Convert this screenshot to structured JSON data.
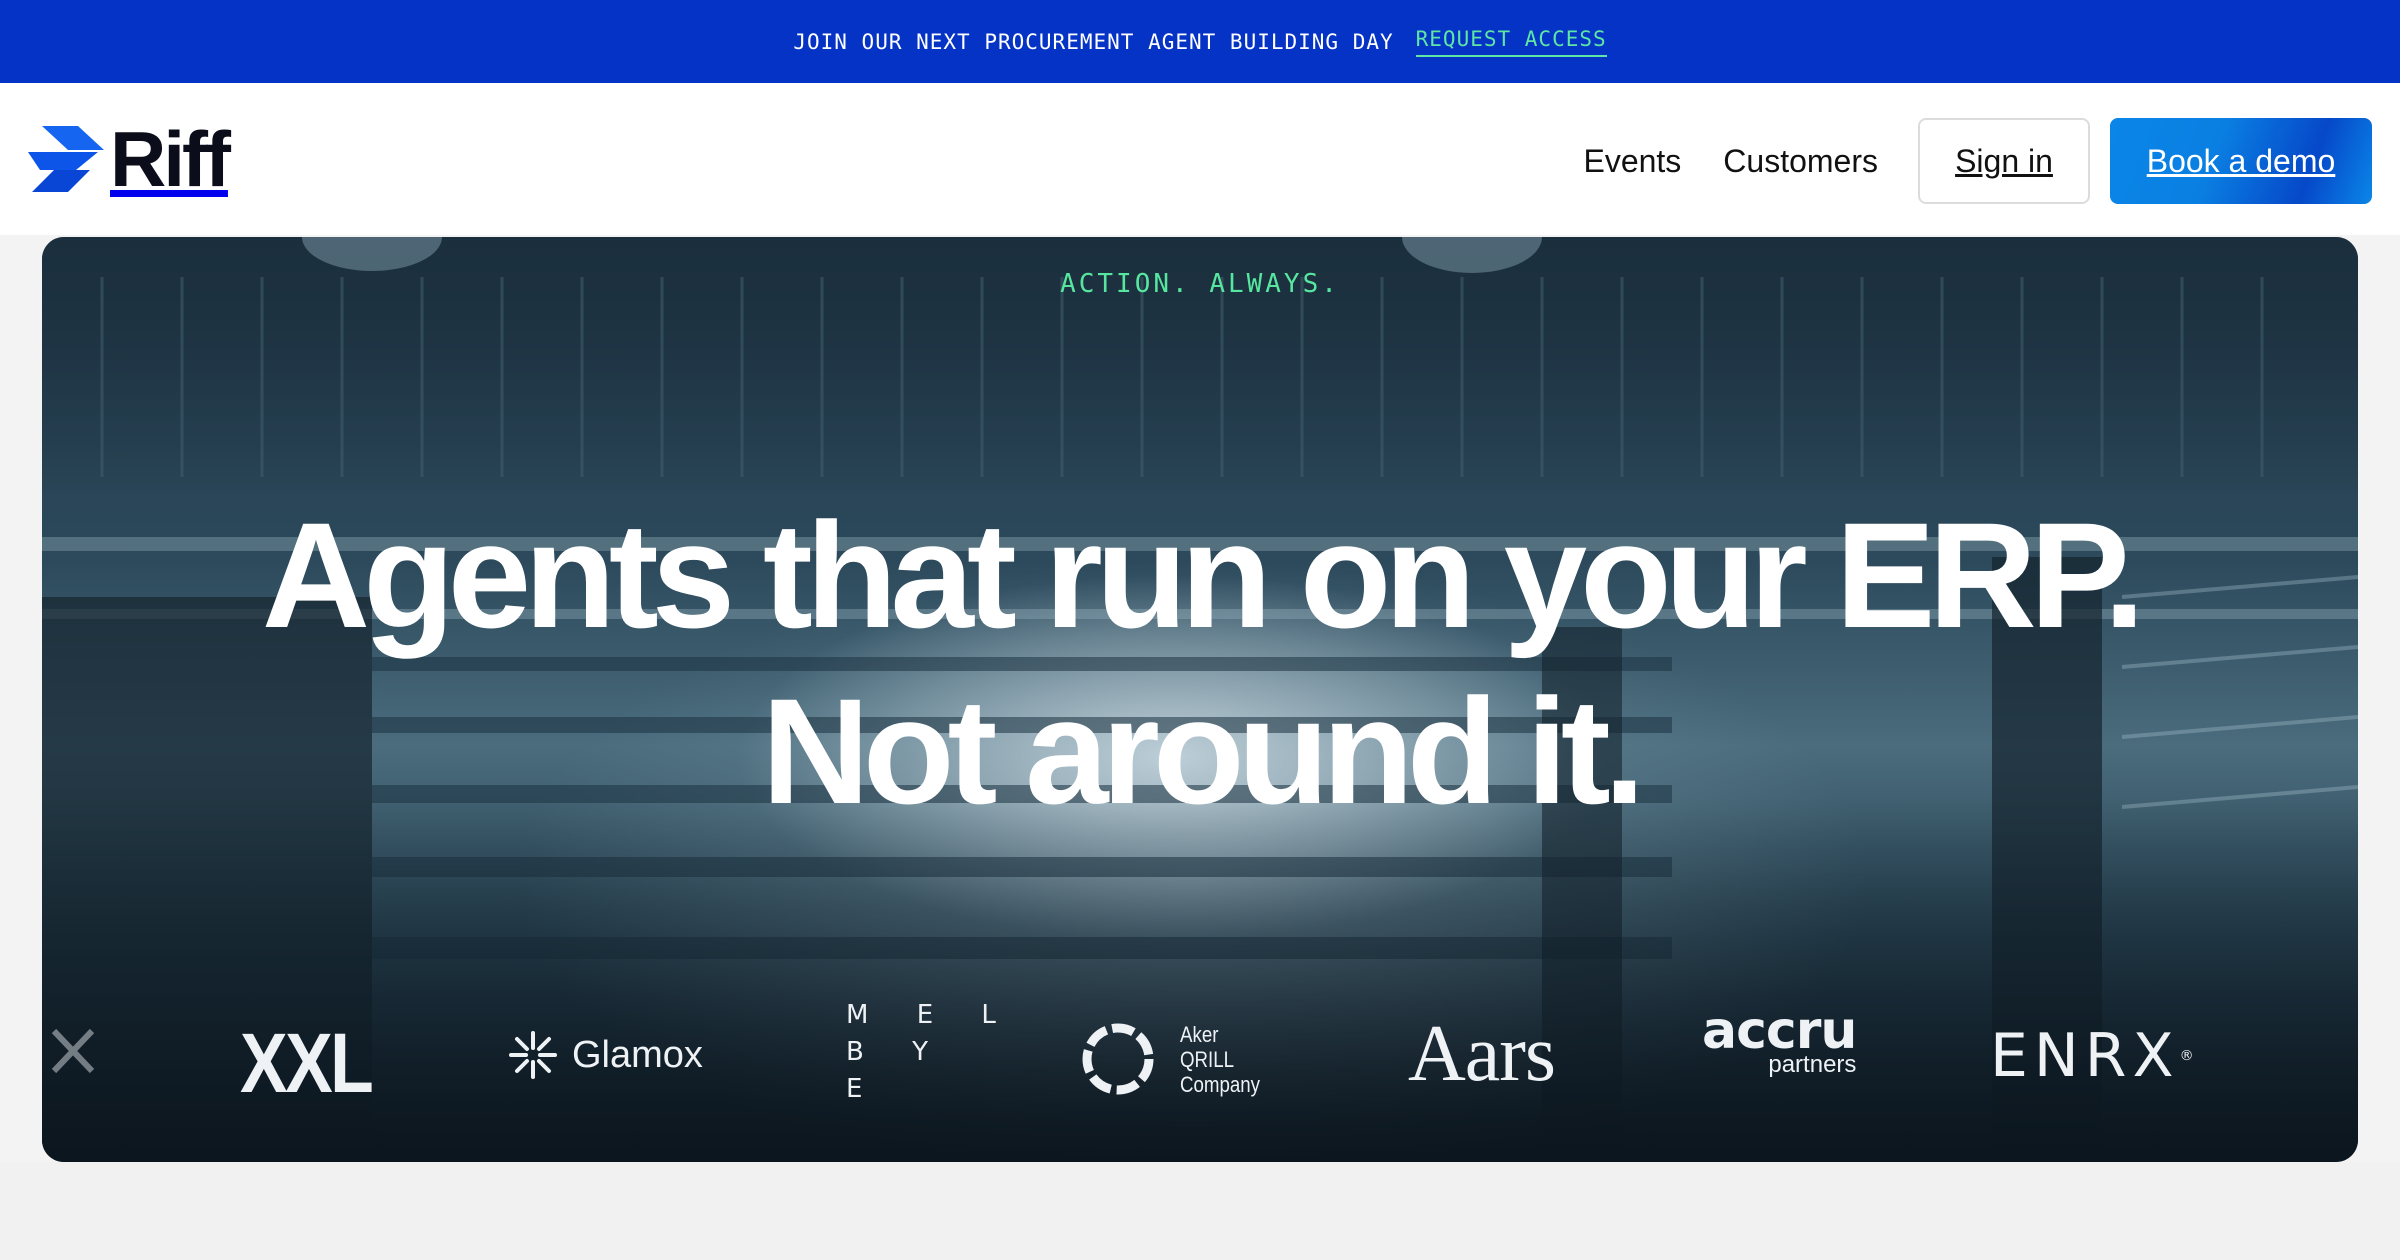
{
  "announcement": {
    "text": "JOIN OUR NEXT PROCUREMENT AGENT BUILDING DAY",
    "link_label": "REQUEST ACCESS",
    "background": "#0433c5",
    "link_color": "#5ee6a5"
  },
  "header": {
    "logo_text": "Riff",
    "logo_icon": "riff-chevron-icon",
    "nav": {
      "events": "Events",
      "customers": "Customers"
    },
    "sign_in_label": "Sign in",
    "book_demo_label": "Book a demo",
    "accent": "#0a7fe2"
  },
  "hero": {
    "tagline": "ACTION. ALWAYS.",
    "headline_line1": "Agents that run on your ERP.",
    "headline_line2": "Not around it.",
    "tagline_color": "#57e69f"
  },
  "customer_logos": {
    "partial": "X",
    "xxl": "XXL",
    "glamox": "Glamox",
    "melbye_row1": "M E L",
    "melbye_row2": "B Y",
    "melbye_row3": "E",
    "aker_line1": "Aker",
    "aker_line2": "QRILL",
    "aker_line3": "Company",
    "aars": "Aars",
    "accru_main": "accru",
    "accru_sub": "partners",
    "enrx": "ENRX",
    "enrx_mark": "®"
  }
}
